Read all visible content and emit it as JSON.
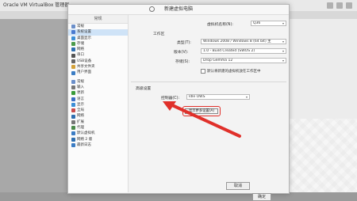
{
  "app": {
    "title": "Oracle VM VirtualBox 管理器"
  },
  "dialog": {
    "title": "新建虚拟电脑",
    "sidebar_header": "常规",
    "sidebar_items": [
      {
        "label": "常规",
        "icon": "general-icon",
        "color": "#6b8fc9"
      },
      {
        "label": "系统设置",
        "icon": "system-icon",
        "color": "#4a7bd0",
        "selected": true
      },
      {
        "label": "桌面显示",
        "icon": "display-icon",
        "color": "#3d8fd6"
      },
      {
        "label": "存储",
        "icon": "storage-icon",
        "color": "#4c9b4c"
      },
      {
        "label": "网络",
        "icon": "network-icon",
        "color": "#2f6fb0"
      },
      {
        "label": "串口",
        "icon": "serial-icon",
        "color": "#555"
      },
      {
        "label": "USB设备",
        "icon": "usb-icon",
        "color": "#666"
      },
      {
        "label": "共享文件夹",
        "icon": "folder-icon",
        "color": "#d4a23b"
      },
      {
        "label": "用户界面",
        "icon": "ui-icon",
        "color": "#3c7dc4"
      },
      {
        "label": "",
        "separator": true
      },
      {
        "label": "常规",
        "icon": "general2-icon",
        "color": "#6b8fc9"
      },
      {
        "label": "输入",
        "icon": "input-icon",
        "color": "#777"
      },
      {
        "label": "更新",
        "icon": "update-icon",
        "color": "#3a9b3a"
      },
      {
        "label": "语言",
        "icon": "language-icon",
        "color": "#3b6dc4"
      },
      {
        "label": "显示",
        "icon": "display2-icon",
        "color": "#3d8fd6"
      },
      {
        "label": "全局",
        "icon": "global-icon",
        "color": "#c94c4c"
      },
      {
        "label": "网络",
        "icon": "network2-icon",
        "color": "#2f6fb0"
      },
      {
        "label": "扩展",
        "icon": "extension-icon",
        "color": "#777"
      },
      {
        "label": "代理",
        "icon": "proxy-icon",
        "color": "#4a8a4a"
      },
      {
        "label": "默认虚拟机",
        "icon": "default-vm-icon",
        "color": "#3c7dc4"
      },
      {
        "label": "网络 2 版",
        "icon": "network3-icon",
        "color": "#2f6fb0"
      },
      {
        "label": "最新日志",
        "icon": "log-icon",
        "color": "#3c7dc4"
      }
    ],
    "fields": {
      "config_label": "虚拟机名称(N):",
      "config_value": "Q36",
      "section_title": "工作区",
      "os_type_label": "类型(T):",
      "os_type_value": "Windows 2008 / Windows 8 (64 bit) 主",
      "version_label": "版本(V):",
      "version_value": "1.0 - Build Created (SWOS 2)",
      "storage_label": "存储(S):",
      "storage_value": "Drop Gemma 12",
      "checkbox_label": "默认将新建的虚拟机放在工作区中",
      "advanced_section": "高级设置",
      "controller_label": "控制器(C):",
      "controller_value": "Idle OWS"
    },
    "advanced_button": "显示更多设置(A)",
    "ok_button": "确定",
    "cancel_button": "取消"
  },
  "colors": {
    "highlight": "#e0302a",
    "selected": "#cfe3f7"
  }
}
